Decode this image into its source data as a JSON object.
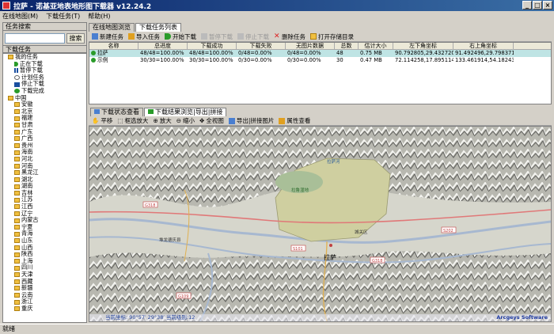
{
  "window": {
    "title": "拉萨 - 诺基亚地表地形图下载器 v12.24.2"
  },
  "menu": [
    "在线地图(M)",
    "下载任务(T)",
    "帮助(H)"
  ],
  "left": {
    "search_header": "任务搜索",
    "search_button": "搜索",
    "list_header": "下载任务",
    "my_tasks": "我的任务",
    "status_items": [
      "正在下载",
      "暂停下载",
      "计划任务",
      "停止下载",
      "下载完成"
    ],
    "china": "中国",
    "provinces": [
      "安徽",
      "北京",
      "福建",
      "甘肃",
      "广东",
      "广西",
      "贵州",
      "海南",
      "河北",
      "河南",
      "黑龙江",
      "湖北",
      "湖南",
      "吉林",
      "江苏",
      "江西",
      "辽宁",
      "内蒙古",
      "宁夏",
      "青海",
      "山东",
      "山西",
      "陕西",
      "上海",
      "四川",
      "天津",
      "西藏",
      "新疆",
      "云南",
      "浙江",
      "重庆"
    ]
  },
  "tabs": [
    "在线地图浏览",
    "下载任务列表"
  ],
  "toolbar": [
    "新建任务",
    "导入任务",
    "开始下载",
    "暂停下载",
    "停止下载",
    "删除任务",
    "打开存储目录"
  ],
  "table": {
    "headers": [
      "名称",
      "总进度",
      "下载成功",
      "下载失败",
      "无图片数据",
      "总数",
      "估计大小",
      "左下角坐标",
      "右上角坐标"
    ],
    "rows": [
      [
        "拉萨",
        "48/48=100.00%",
        "48/48=100.00%",
        "0/48=0.00%",
        "0/48=0.00%",
        "48",
        "0.75 MB",
        "90.792805,29.432720",
        "91.492496,29.798371"
      ],
      [
        "示例",
        "30/30=100.00%",
        "30/30=100.00%",
        "0/30=0.00%",
        "0/30=0.00%",
        "30",
        "0.47 MB",
        "72.114258,17.895114",
        "133.461914,54.182434"
      ]
    ]
  },
  "view_tabs": [
    "下载状态查看",
    "下载结果浏览|导出|拼接"
  ],
  "map_tools": [
    "平移",
    "框选放大",
    "放大",
    "缩小",
    "全视图",
    "导出|拼接图片",
    "属性查看"
  ],
  "map": {
    "labels": {
      "city": "拉萨",
      "lhasa_river": "拉萨河",
      "park": "拉鲁湿地",
      "chengguan": "城关区",
      "duilongdeqing": "堆龙德庆县",
      "g318": "G318",
      "s101": "S101",
      "s202": "S202",
      "g109": "G109",
      "g318b": "G318"
    },
    "status": "当前坐标: 90°57′ 29°38′   当前级别:12",
    "brand": "Arcgeys Software"
  },
  "statusbar": "就绪"
}
